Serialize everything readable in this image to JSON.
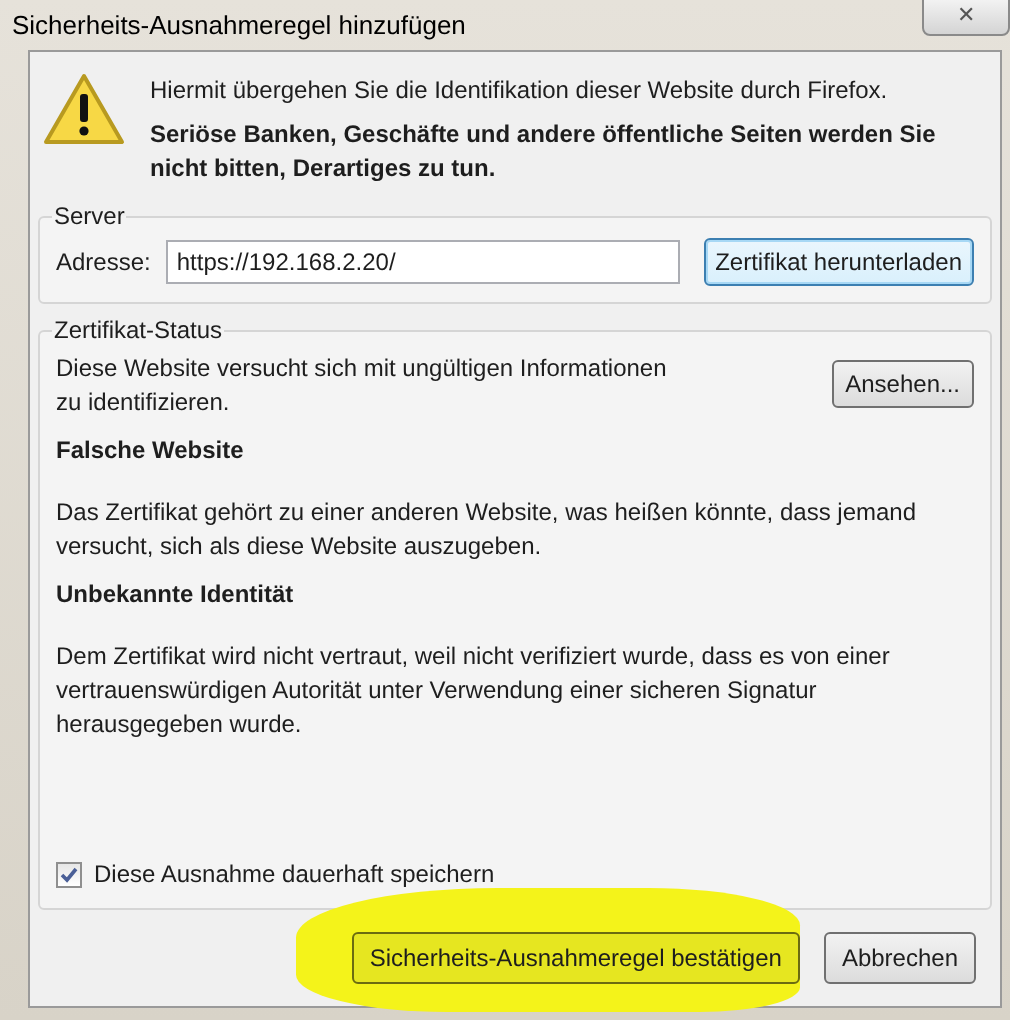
{
  "window": {
    "title": "Sicherheits-Ausnahmeregel hinzufügen",
    "close": "✕"
  },
  "warning": {
    "line": "Hiermit übergehen Sie die Identifikation dieser Website durch Firefox.",
    "emphasis": "Seriöse Banken, Geschäfte und andere öffentliche Seiten werden Sie nicht bitten, Derartiges zu tun."
  },
  "server": {
    "legend": "Server",
    "address_label": "Adresse:",
    "address_value": "https://192.168.2.20/",
    "download_button": "Zertifikat herunterladen"
  },
  "certificate_status": {
    "legend": "Zertifikat-Status",
    "summary": "Diese Website versucht sich mit ungültigen Informationen zu identifizieren.",
    "view_button": "Ansehen...",
    "problems": [
      {
        "heading": "Falsche Website",
        "text": "Das Zertifikat gehört zu einer anderen Website, was heißen könnte, dass jemand versucht, sich als diese Website auszugeben."
      },
      {
        "heading": "Unbekannte Identität",
        "text": "Dem Zertifikat wird nicht vertraut, weil nicht verifiziert wurde, dass es von einer vertrauenswürdigen Autorität unter Verwendung einer sicheren Signatur herausgegeben wurde."
      }
    ],
    "permanent": {
      "label": "Diese Ausnahme dauerhaft speichern",
      "checked": true
    }
  },
  "buttons": [
    {
      "label": "Sicherheits-Ausnahmeregel bestätigen",
      "highlighted": true
    },
    {
      "label": "Abbrechen",
      "highlighted": false
    }
  ]
}
